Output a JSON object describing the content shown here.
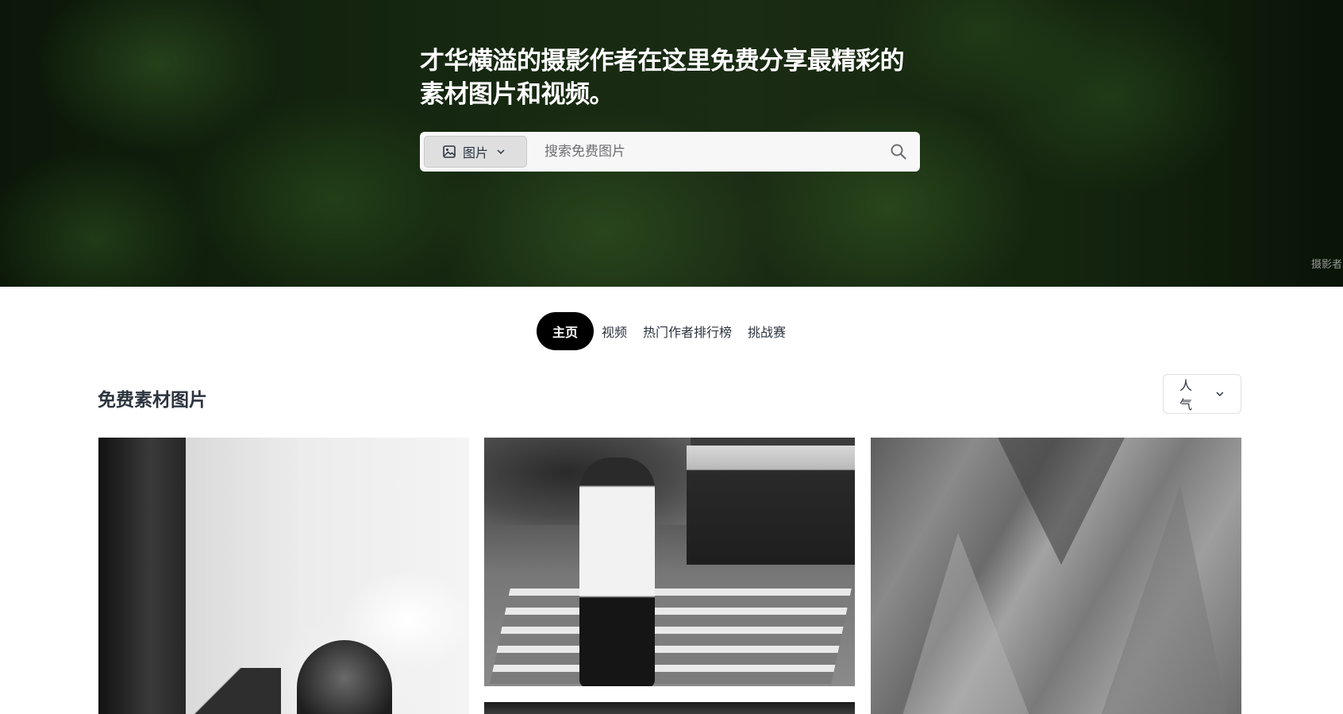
{
  "hero": {
    "title": "才华横溢的摄影作者在这里免费分享最精彩的素材图片和视频。",
    "photo_credit": "摄影者",
    "search": {
      "type_label": "图片",
      "placeholder": "搜索免费图片"
    }
  },
  "tabs": [
    {
      "label": "主页",
      "active": true
    },
    {
      "label": "视频",
      "active": false
    },
    {
      "label": "热门作者排行榜",
      "active": false
    },
    {
      "label": "挑战赛",
      "active": false
    }
  ],
  "section": {
    "title": "免费素材图片",
    "sort_label": "人气"
  },
  "icons": {
    "type_select": "image-icon",
    "dropdown": "chevron-down-icon",
    "search": "search-icon"
  },
  "colors": {
    "active_tab_bg": "#000000",
    "active_tab_text": "#ffffff",
    "text": "#2c343e"
  }
}
